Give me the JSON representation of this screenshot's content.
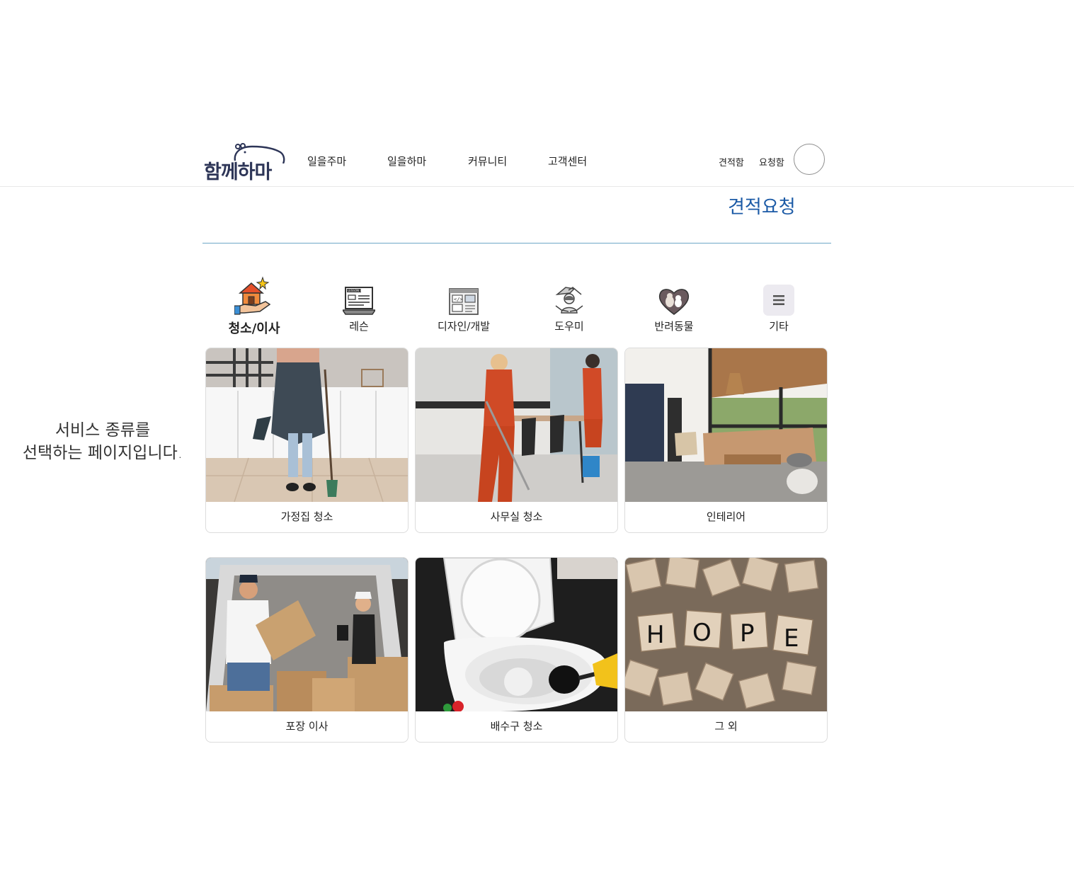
{
  "header": {
    "logo_text": "함께하마",
    "nav": [
      "일을주마",
      "일을하마",
      "커뮤니티",
      "고객센터"
    ],
    "utility": [
      "견적함",
      "요청함"
    ]
  },
  "page_title": "견적요청",
  "categories": [
    {
      "label": "청소/이사",
      "icon": "house-hand-icon",
      "active": true
    },
    {
      "label": "레슨",
      "icon": "lesson-screen-icon"
    },
    {
      "label": "디자인/개발",
      "icon": "code-window-icon"
    },
    {
      "label": "도우미",
      "icon": "helper-hands-icon"
    },
    {
      "label": "반려동물",
      "icon": "pet-heart-icon"
    },
    {
      "label": "기타",
      "icon": "menu-icon"
    }
  ],
  "side_caption": [
    "서비스 종류를",
    "선택하는 페이지입니다."
  ],
  "services": [
    {
      "label": "가정집 청소",
      "image": "kitchen-cleaning-photo"
    },
    {
      "label": "사무실 청소",
      "image": "office-cleaning-photo"
    },
    {
      "label": "인테리어",
      "image": "living-room-interior-photo"
    },
    {
      "label": "포장 이사",
      "image": "moving-boxes-photo"
    },
    {
      "label": "배수구 청소",
      "image": "toilet-plunger-photo"
    },
    {
      "label": "그 외",
      "image": "scrabble-hope-tiles-photo"
    }
  ],
  "hope_tiles": [
    "H",
    "O",
    "P",
    "E"
  ]
}
